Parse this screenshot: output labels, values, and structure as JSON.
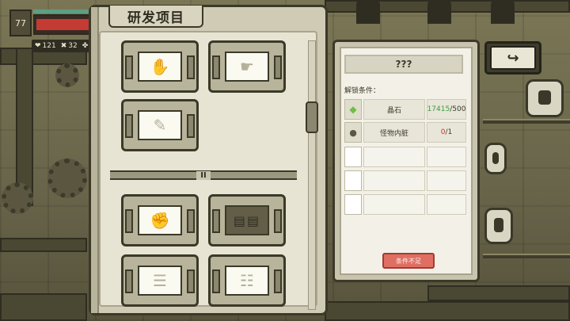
{
  "hud": {
    "level": "77",
    "hp_fraction": 0.92,
    "stats": [
      {
        "icon": "heart-icon",
        "glyph": "❤",
        "value": "121"
      },
      {
        "icon": "armor-icon",
        "glyph": "✖",
        "value": "32"
      },
      {
        "icon": "clover-icon",
        "glyph": "✤",
        "value": "17"
      }
    ]
  },
  "research": {
    "title": "研发项目",
    "divider_label": "II",
    "group1": [
      {
        "name": "research-card-1",
        "glyph": "✋",
        "locked": false
      },
      {
        "name": "research-card-2",
        "glyph": "☛",
        "locked": false
      },
      {
        "name": "research-card-3",
        "glyph": "✎",
        "locked": false
      }
    ],
    "group2": [
      {
        "name": "research-card-4",
        "glyph": "✊",
        "locked": false
      },
      {
        "name": "research-card-5",
        "glyph": "▤▤",
        "locked": true
      },
      {
        "name": "research-card-6",
        "glyph": "☰",
        "locked": false
      },
      {
        "name": "research-card-7",
        "glyph": "☷",
        "locked": false
      }
    ]
  },
  "detail": {
    "project_name": "???",
    "conditions_label": "解锁条件：",
    "requirements": [
      {
        "icon": "crystal-icon",
        "glyph": "◆",
        "name": "晶石",
        "have": "17415",
        "need": "/500",
        "status": "ok"
      },
      {
        "icon": "organ-icon",
        "glyph": "●",
        "name": "怪物内脏",
        "have": "0",
        "need": "/1",
        "status": "bad"
      }
    ],
    "empty_rows": 3,
    "button_label": "条件不足"
  },
  "back_button": {
    "glyph": "↪"
  }
}
